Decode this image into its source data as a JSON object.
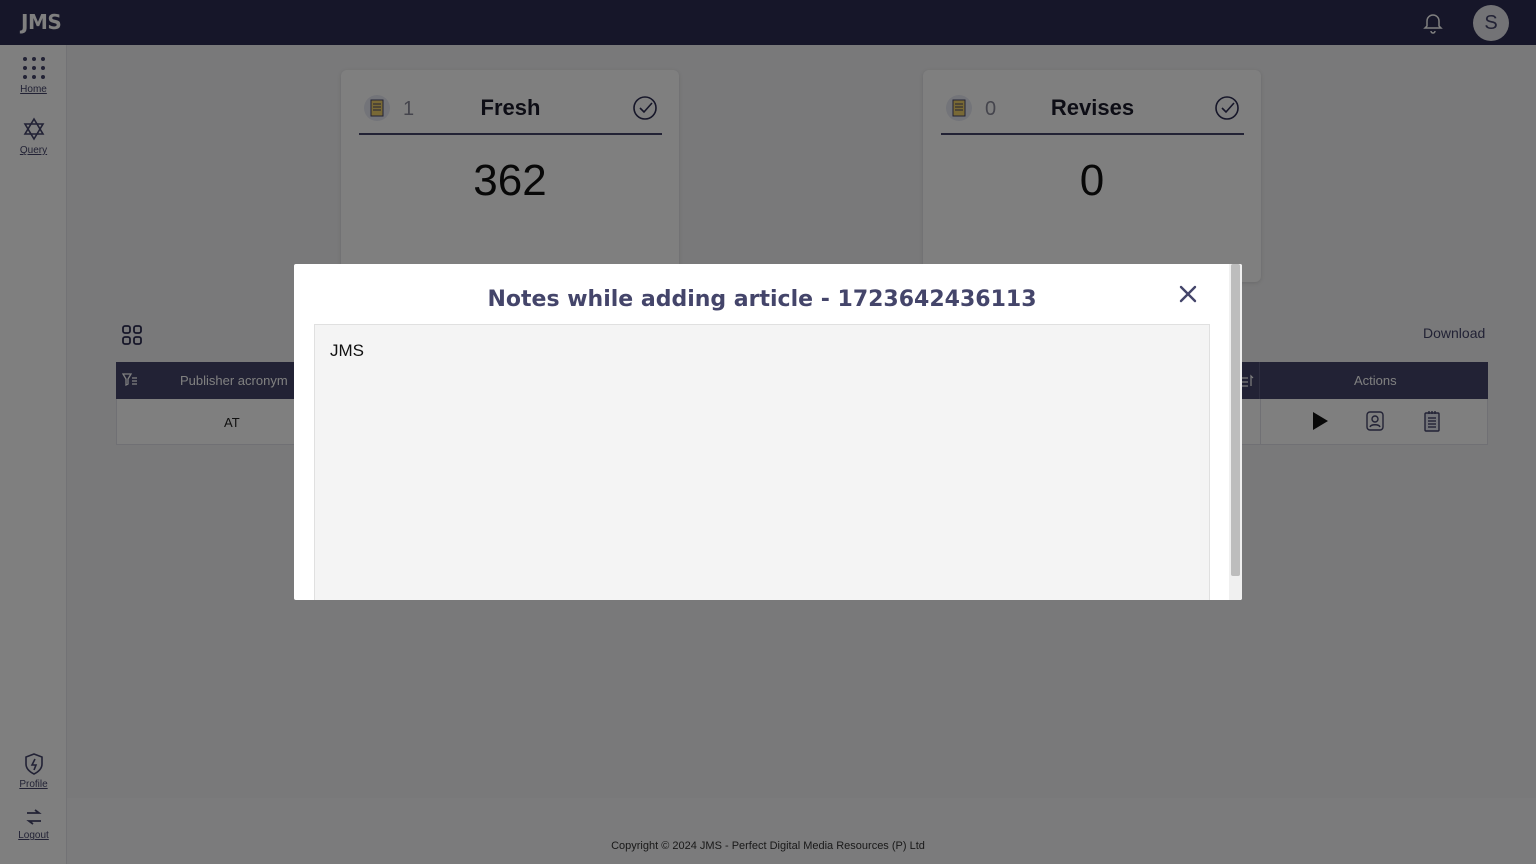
{
  "app": {
    "logo": "JMS"
  },
  "header": {
    "avatar_initial": "S"
  },
  "sidebar": {
    "items": [
      {
        "label": "Home",
        "icon": "grid-dots-icon"
      },
      {
        "label": "Query",
        "icon": "query-icon"
      },
      {
        "label": "Profile",
        "icon": "shield-bolt-icon"
      },
      {
        "label": "Logout",
        "icon": "logout-icon"
      }
    ]
  },
  "cards": [
    {
      "count": "1",
      "title": "Fresh",
      "value": "362"
    },
    {
      "count": "0",
      "title": "Revises",
      "value": "0"
    }
  ],
  "table": {
    "download_label": "Download",
    "headers": {
      "publisher_acronym": "Publisher acronym",
      "actions": "Actions"
    },
    "rows": [
      {
        "publisher_acronym": "AT"
      }
    ]
  },
  "footer": {
    "copyright": "Copyright © 2024 JMS - Perfect Digital Media Resources (P) Ltd"
  },
  "modal": {
    "title": "Notes while adding article - 1723642436113",
    "notes": "JMS"
  },
  "colors": {
    "primary": "#44456a",
    "topbar": "#2c2d52",
    "overlay": "rgba(0,0,0,0.5)"
  }
}
